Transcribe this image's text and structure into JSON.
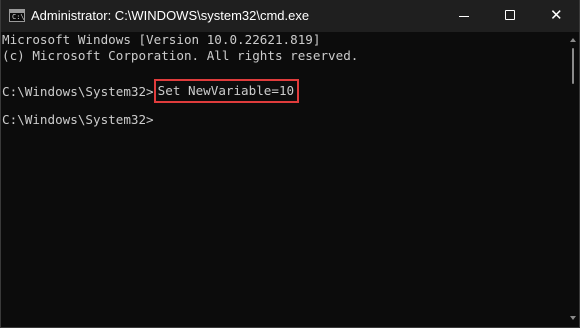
{
  "window": {
    "title": "Administrator: C:\\WINDOWS\\system32\\cmd.exe",
    "app_icon_glyph": "C:\\",
    "controls": {
      "minimize": "minimize-icon",
      "maximize": "maximize-icon",
      "close": "close-icon"
    }
  },
  "console": {
    "lines": [
      "Microsoft Windows [Version 10.0.22621.819]",
      "(c) Microsoft Corporation. All rights reserved.",
      "",
      "C:\\Windows\\System32>",
      "",
      "C:\\Windows\\System32>"
    ],
    "highlighted_command": "Set NewVariable=10",
    "highlight_color": "#e03c3c",
    "text_color": "#cccccc",
    "background_color": "#0c0c0c"
  }
}
